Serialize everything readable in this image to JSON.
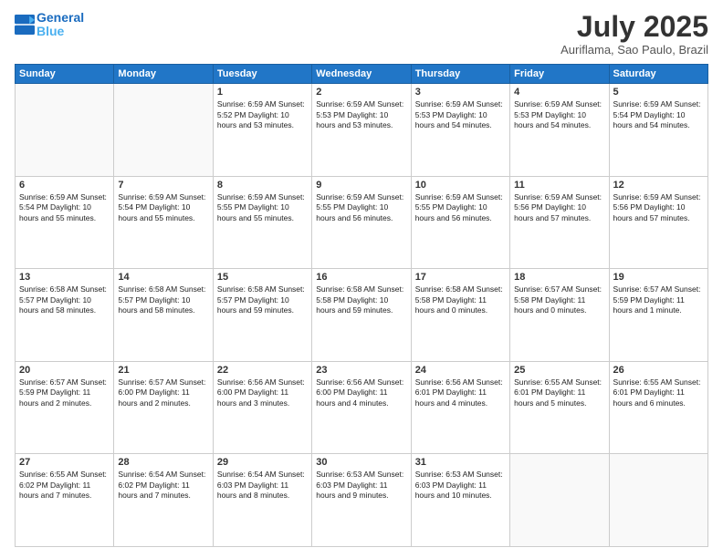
{
  "header": {
    "logo_line1": "General",
    "logo_line2": "Blue",
    "month": "July 2025",
    "location": "Auriflama, Sao Paulo, Brazil"
  },
  "weekdays": [
    "Sunday",
    "Monday",
    "Tuesday",
    "Wednesday",
    "Thursday",
    "Friday",
    "Saturday"
  ],
  "weeks": [
    [
      {
        "day": "",
        "info": ""
      },
      {
        "day": "",
        "info": ""
      },
      {
        "day": "1",
        "info": "Sunrise: 6:59 AM\nSunset: 5:52 PM\nDaylight: 10 hours and 53 minutes."
      },
      {
        "day": "2",
        "info": "Sunrise: 6:59 AM\nSunset: 5:53 PM\nDaylight: 10 hours and 53 minutes."
      },
      {
        "day": "3",
        "info": "Sunrise: 6:59 AM\nSunset: 5:53 PM\nDaylight: 10 hours and 54 minutes."
      },
      {
        "day": "4",
        "info": "Sunrise: 6:59 AM\nSunset: 5:53 PM\nDaylight: 10 hours and 54 minutes."
      },
      {
        "day": "5",
        "info": "Sunrise: 6:59 AM\nSunset: 5:54 PM\nDaylight: 10 hours and 54 minutes."
      }
    ],
    [
      {
        "day": "6",
        "info": "Sunrise: 6:59 AM\nSunset: 5:54 PM\nDaylight: 10 hours and 55 minutes."
      },
      {
        "day": "7",
        "info": "Sunrise: 6:59 AM\nSunset: 5:54 PM\nDaylight: 10 hours and 55 minutes."
      },
      {
        "day": "8",
        "info": "Sunrise: 6:59 AM\nSunset: 5:55 PM\nDaylight: 10 hours and 55 minutes."
      },
      {
        "day": "9",
        "info": "Sunrise: 6:59 AM\nSunset: 5:55 PM\nDaylight: 10 hours and 56 minutes."
      },
      {
        "day": "10",
        "info": "Sunrise: 6:59 AM\nSunset: 5:55 PM\nDaylight: 10 hours and 56 minutes."
      },
      {
        "day": "11",
        "info": "Sunrise: 6:59 AM\nSunset: 5:56 PM\nDaylight: 10 hours and 57 minutes."
      },
      {
        "day": "12",
        "info": "Sunrise: 6:59 AM\nSunset: 5:56 PM\nDaylight: 10 hours and 57 minutes."
      }
    ],
    [
      {
        "day": "13",
        "info": "Sunrise: 6:58 AM\nSunset: 5:57 PM\nDaylight: 10 hours and 58 minutes."
      },
      {
        "day": "14",
        "info": "Sunrise: 6:58 AM\nSunset: 5:57 PM\nDaylight: 10 hours and 58 minutes."
      },
      {
        "day": "15",
        "info": "Sunrise: 6:58 AM\nSunset: 5:57 PM\nDaylight: 10 hours and 59 minutes."
      },
      {
        "day": "16",
        "info": "Sunrise: 6:58 AM\nSunset: 5:58 PM\nDaylight: 10 hours and 59 minutes."
      },
      {
        "day": "17",
        "info": "Sunrise: 6:58 AM\nSunset: 5:58 PM\nDaylight: 11 hours and 0 minutes."
      },
      {
        "day": "18",
        "info": "Sunrise: 6:57 AM\nSunset: 5:58 PM\nDaylight: 11 hours and 0 minutes."
      },
      {
        "day": "19",
        "info": "Sunrise: 6:57 AM\nSunset: 5:59 PM\nDaylight: 11 hours and 1 minute."
      }
    ],
    [
      {
        "day": "20",
        "info": "Sunrise: 6:57 AM\nSunset: 5:59 PM\nDaylight: 11 hours and 2 minutes."
      },
      {
        "day": "21",
        "info": "Sunrise: 6:57 AM\nSunset: 6:00 PM\nDaylight: 11 hours and 2 minutes."
      },
      {
        "day": "22",
        "info": "Sunrise: 6:56 AM\nSunset: 6:00 PM\nDaylight: 11 hours and 3 minutes."
      },
      {
        "day": "23",
        "info": "Sunrise: 6:56 AM\nSunset: 6:00 PM\nDaylight: 11 hours and 4 minutes."
      },
      {
        "day": "24",
        "info": "Sunrise: 6:56 AM\nSunset: 6:01 PM\nDaylight: 11 hours and 4 minutes."
      },
      {
        "day": "25",
        "info": "Sunrise: 6:55 AM\nSunset: 6:01 PM\nDaylight: 11 hours and 5 minutes."
      },
      {
        "day": "26",
        "info": "Sunrise: 6:55 AM\nSunset: 6:01 PM\nDaylight: 11 hours and 6 minutes."
      }
    ],
    [
      {
        "day": "27",
        "info": "Sunrise: 6:55 AM\nSunset: 6:02 PM\nDaylight: 11 hours and 7 minutes."
      },
      {
        "day": "28",
        "info": "Sunrise: 6:54 AM\nSunset: 6:02 PM\nDaylight: 11 hours and 7 minutes."
      },
      {
        "day": "29",
        "info": "Sunrise: 6:54 AM\nSunset: 6:03 PM\nDaylight: 11 hours and 8 minutes."
      },
      {
        "day": "30",
        "info": "Sunrise: 6:53 AM\nSunset: 6:03 PM\nDaylight: 11 hours and 9 minutes."
      },
      {
        "day": "31",
        "info": "Sunrise: 6:53 AM\nSunset: 6:03 PM\nDaylight: 11 hours and 10 minutes."
      },
      {
        "day": "",
        "info": ""
      },
      {
        "day": "",
        "info": ""
      }
    ]
  ]
}
